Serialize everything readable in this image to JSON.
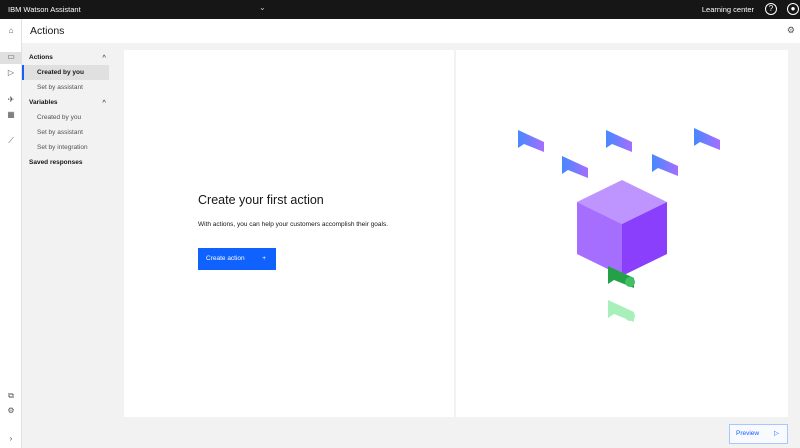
{
  "header": {
    "app_title": "IBM Watson Assistant",
    "learning_center": "Learning center"
  },
  "page": {
    "title": "Actions"
  },
  "sidebar": {
    "actions_group": "Actions",
    "actions_items": [
      "Created by you",
      "Set by assistant"
    ],
    "variables_group": "Variables",
    "variables_items": [
      "Created by you",
      "Set by assistant",
      "Set by integration"
    ],
    "saved_responses": "Saved responses"
  },
  "main": {
    "heading": "Create your first action",
    "description": "With actions, you can help your customers accomplish their goals.",
    "create_button": "Create action",
    "create_icon": "+"
  },
  "footer": {
    "preview_button": "Preview"
  },
  "colors": {
    "accent": "#0f62fe",
    "topbar": "#161616"
  }
}
